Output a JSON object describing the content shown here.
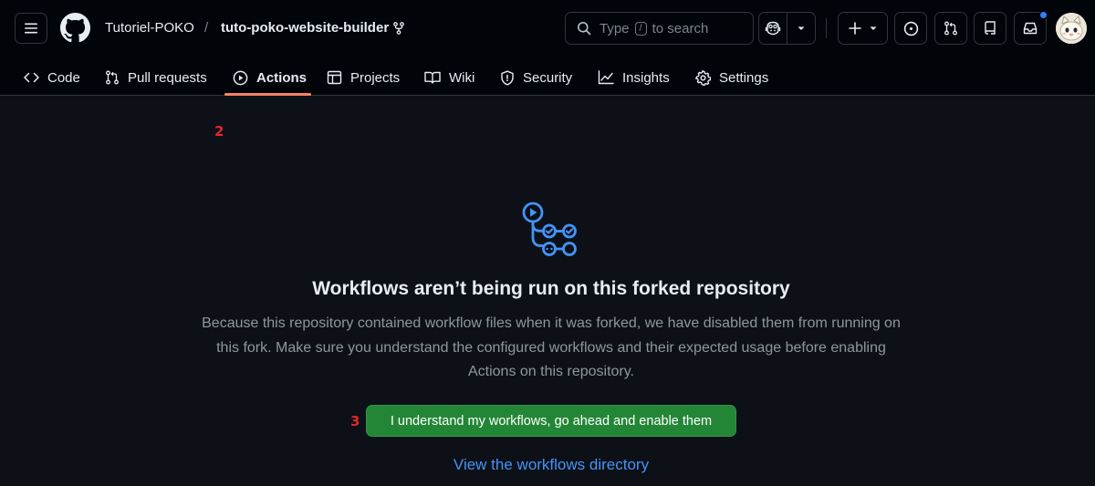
{
  "repo": {
    "owner": "Tutoriel-POKO",
    "separator": "/",
    "name": "tuto-poko-website-builder"
  },
  "search": {
    "prefix": "Type",
    "key": "/",
    "suffix": "to search"
  },
  "tabs": [
    {
      "label": "Code",
      "icon": "code-icon"
    },
    {
      "label": "Pull requests",
      "icon": "git-pull-request-icon"
    },
    {
      "label": "Actions",
      "icon": "play-icon",
      "active": true
    },
    {
      "label": "Projects",
      "icon": "table-icon"
    },
    {
      "label": "Wiki",
      "icon": "book-icon"
    },
    {
      "label": "Security",
      "icon": "shield-icon"
    },
    {
      "label": "Insights",
      "icon": "graph-icon"
    },
    {
      "label": "Settings",
      "icon": "gear-icon"
    }
  ],
  "annotations": {
    "pull_requests": "2",
    "enable_button": "3"
  },
  "empty_state": {
    "title": "Workflows aren’t being run on this forked repository",
    "description": "Because this repository contained workflow files when it was forked, we have disabled them from running on this fork. Make sure you understand the configured workflows and their expected usage before enabling Actions on this repository.",
    "enable_button": "I understand my workflows, go ahead and enable them",
    "view_link": "View the workflows directory"
  },
  "colors": {
    "background": "#0d1117",
    "header": "#010409",
    "primary_button": "#238636",
    "link": "#4493f8",
    "active_tab_underline": "#f78166",
    "annotation": "#e3262c",
    "notification_dot": "#2f81f7"
  }
}
